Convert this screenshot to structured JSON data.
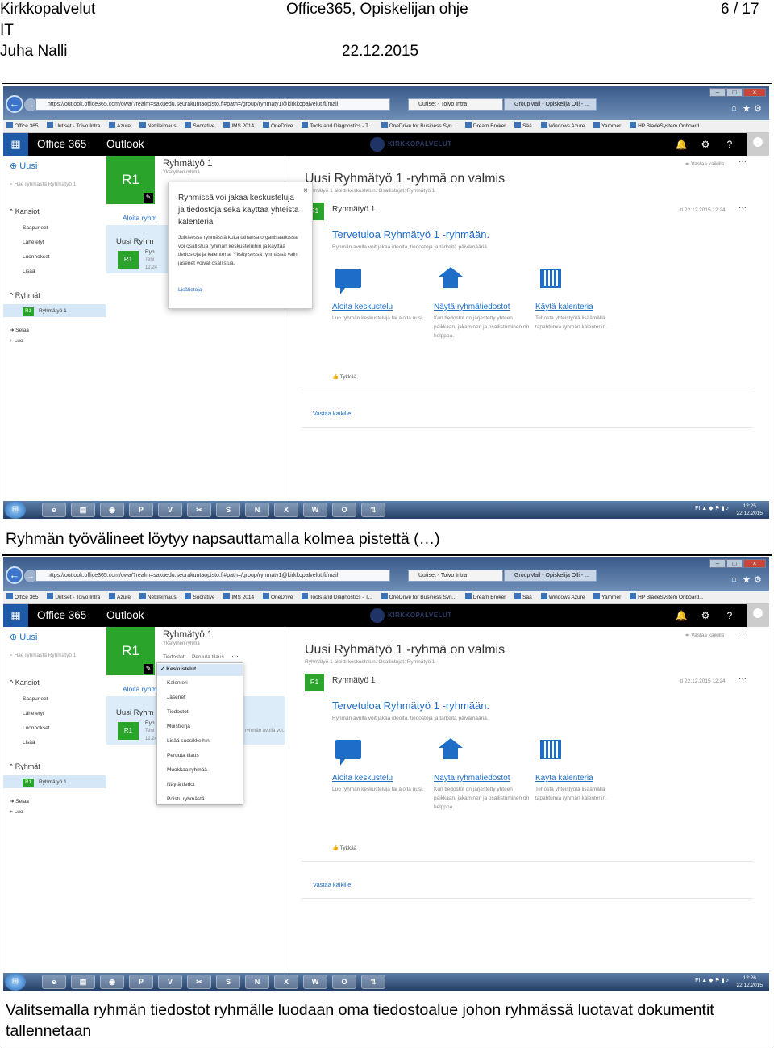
{
  "header": {
    "org_line1": "Kirkkopalvelut",
    "org_line2": "IT",
    "author": "Juha Nalli",
    "title": "Office365, Opiskelijan ohje",
    "date": "22.12.2015",
    "page": "6 / 17"
  },
  "captions": {
    "first": "Ryhmän työvälineet löytyy napsauttamalla kolmea pistettä (…)",
    "second": "Valitsemalla ryhmän tiedostot ryhmälle luodaan oma tiedostoalue johon ryhmässä luotavat dokumentit tallennetaan"
  },
  "browser": {
    "url": "https://outlook.office365.com/owa/?realm=sakuedu.seurakuntaopisto.fi#path=/group/ryhmaty1@kirkkopalvelut.fi/mail",
    "tab1": "Uutiset - Toivo Intra",
    "tab2": "GroupMail - Opiskelija Olli - ...",
    "favorites": [
      "Office 365",
      "Uutiset - Toivo Intra",
      "Azure",
      "Nettileimaus",
      "Socrative",
      "IMS 2014",
      "OneDrive",
      "Tools and Diagnostics - T...",
      "OneDrive for Business Syn...",
      "Dream Broker",
      "Sää",
      "Windows Azure",
      "Yammer",
      "HP BladeSystem Onboard..."
    ]
  },
  "o365": {
    "brand": "Office 365",
    "app": "Outlook",
    "org_name": "KIRKKOPALVELUT"
  },
  "left_pane": {
    "new": "Uusi",
    "search_placeholder": "Hae ryhmästä Ryhmätyö 1",
    "folders_head": "Kansiot",
    "folders": [
      "Saapuneet",
      "Lähetetyt",
      "Luonnokset",
      "Lisää"
    ],
    "groups_head": "Ryhmät",
    "group_item": "Ryhmätyö 1",
    "browse": "Selaa",
    "create": "Luo",
    "r1": "R1"
  },
  "group_card": {
    "name": "Ryhmätyö 1",
    "type": "Yksityinen ryhmä",
    "tab_files": "Tiedostot",
    "tab_unsub": "Peruuta tilaus",
    "start_conv": "Aloita ryhmäkeskustelu",
    "start_conv_short": "Aloita ryhm",
    "list_header": "Uusi Ryhmätyö 1 -ryhmä on valmis",
    "list_header_short": "Uusi Ryhm",
    "list_sender": "Ryhmätyö 1",
    "list_sender_short": "Ryh",
    "list_preview": "Tervetuloa Ryhmätyö 1 -ryhmään.",
    "list_preview_short": "Terv",
    "list_preview_tail": "ryhmän avulla voi...",
    "list_time": "12.24"
  },
  "popup": {
    "title": "Ryhmissä voi jakaa keskusteluja ja tiedostoja sekä käyttää yhteistä kalenteria",
    "body": "Julkisessa ryhmässä kuka tahansa organisaatiossa voi osallistua ryhmän keskusteluihin ja käyttää tiedostoja ja kalenteria. Yksityisessä ryhmässä vain jäsenet voivat osallistua.",
    "link": "Lisätietoja"
  },
  "dropdown": {
    "items": [
      "Keskustelut",
      "Kalenteri",
      "Jäsenet",
      "Tiedostot",
      "Muistikirja",
      "Lisää suosikkeihin",
      "Peruuta tilaus",
      "Muokkaa ryhmää",
      "Näytä tiedot",
      "Poistu ryhmästä"
    ]
  },
  "reading": {
    "reply_all_top": "Vastaa kaikille",
    "title": "Uusi Ryhmätyö 1 -ryhmä on valmis",
    "meta": "Ryhmätyö 1 aloitti keskustelun. Osallistujat: Ryhmätyö 1",
    "sender": "Ryhmätyö 1",
    "timestamp": "ti 22.12.2015 12:24",
    "welcome": "Tervetuloa Ryhmätyö 1 -ryhmään.",
    "welcome_sub": "Ryhmän avulla voit jakaa ideoita, tiedostoja ja tärkeitä päivämääriä.",
    "actions": [
      {
        "label": "Aloita keskustelu",
        "desc": "Luo ryhmän keskusteluja tai aloita uusi."
      },
      {
        "label": "Näytä ryhmätiedostot",
        "desc": "Kun tiedostot on järjestetty yhteen paikkaan, jakaminen ja osallistuminen on helppoa."
      },
      {
        "label": "Käytä kalenteria",
        "desc": "Tehosta yhteistyötä lisäämällä tapahtumia ryhmän kalenteriin."
      }
    ],
    "like": "Tykkää",
    "reply_all": "Vastaa kaikille"
  },
  "taskbar": {
    "lang": "FI",
    "clock1_time": "12:25",
    "clock2_time": "12:26",
    "clock_date": "22.12.2015"
  }
}
